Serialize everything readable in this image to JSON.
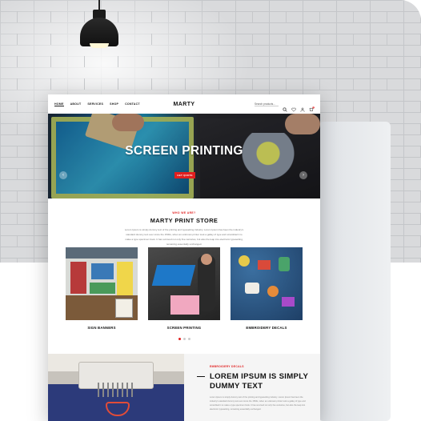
{
  "nav": {
    "links": [
      "HOME",
      "ABOUT",
      "SERVICES",
      "SHOP",
      "CONTACT"
    ],
    "active_index": 0,
    "logo": "MARTY",
    "search_placeholder": "Search products...",
    "cart_count": "0",
    "icons": [
      "search-icon",
      "heart-icon",
      "user-icon",
      "cart-icon"
    ]
  },
  "hero": {
    "title": "SCREEN PRINTING",
    "cta": "GET QUOTE",
    "prev": "‹",
    "next": "›"
  },
  "about": {
    "kicker": "WHO WE ARE?",
    "title": "MARTY PRINT STORE",
    "description": "Lorem Ipsum is simply dummy text of the printing and typesetting industry. Lorem Ipsum has been the industry's standard dummy text ever since the 1500s, when an unknown printer took a galley of type and scrambled it to make a type specimen book. It has survived not only five centuries, but also the leap into electronic typesetting, remaining essentially unchanged."
  },
  "products": [
    {
      "caption": "SIGN BANNERS"
    },
    {
      "caption": "SCREEN PRINTING"
    },
    {
      "caption": "EMBROIDERY DECALS"
    }
  ],
  "carousel_dots": {
    "count": 3,
    "active": 0
  },
  "feature": {
    "kicker": "EMBROIDERY DECALS",
    "heading": "LOREM IPSUM IS SIMPLY DUMMY TEXT",
    "body": "Lorem Ipsum is simply dummy text of the printing and typesetting industry. Lorem Ipsum has been the industry's standard dummy text ever since the 1500s, when an unknown printer took a galley of type and scrambled it to make a type specimen book. It has survived not only five centuries, but also the leap into electronic typesetting, remaining essentially unchanged."
  },
  "colors": {
    "accent": "#e11f1f",
    "text": "#111111",
    "muted": "#777777"
  }
}
